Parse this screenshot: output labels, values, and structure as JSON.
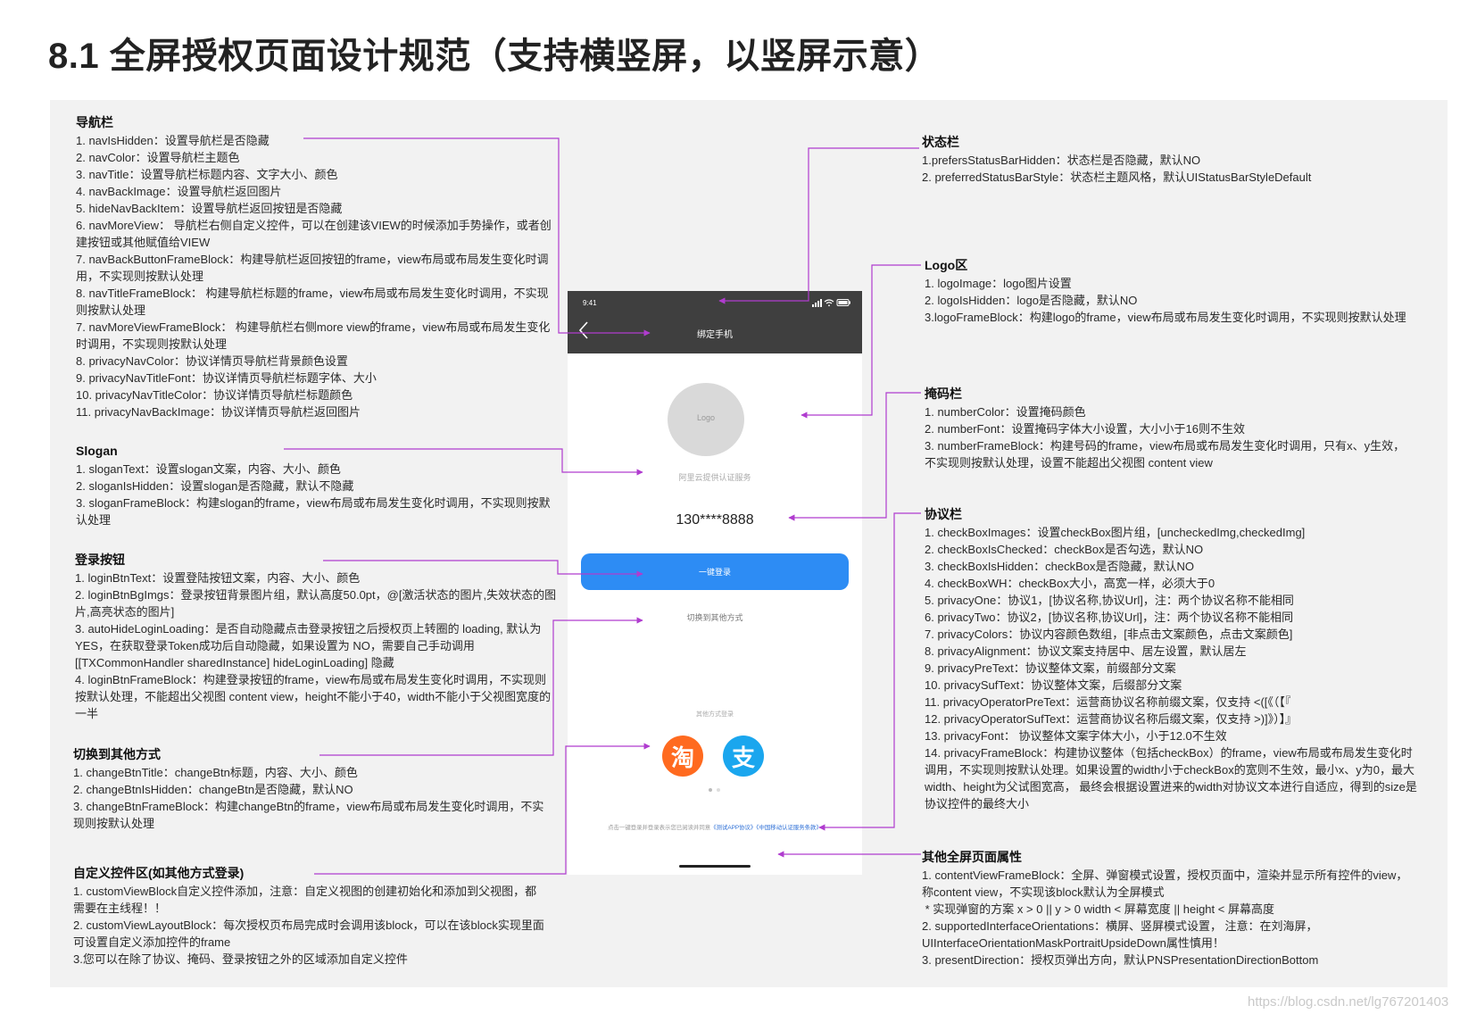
{
  "title": "8.1 全屏授权页面设计规范（支持横竖屏，以竖屏示意）",
  "colors": {
    "connector": "#b03ccf",
    "login_button": "#2d8cf4",
    "nav_bar": "#3f3f3f",
    "panel": "#f2f2f2"
  },
  "sections": {
    "nav": {
      "head": "导航栏",
      "lines": [
        "1. navIsHidden：设置导航栏是否隐藏",
        "2. navColor：设置导航栏主题色",
        "3. navTitle：设置导航栏标题内容、文字大小、颜色",
        "4. navBackImage：设置导航栏返回图片",
        "5. hideNavBackItem：设置导航栏返回按钮是否隐藏",
        "6. navMoreView： 导航栏右侧自定义控件，可以在创建该VIEW的时候添加手势操作，或者创建按钮或其他赋值给VIEW",
        "7. navBackButtonFrameBlock：构建导航栏返回按钮的frame，view布局或布局发生变化时调用，不实现则按默认处理",
        "8. navTitleFrameBlock： 构建导航栏标题的frame，view布局或布局发生变化时调用，不实现则按默认处理",
        "7. navMoreViewFrameBlock： 构建导航栏右侧more view的frame，view布局或布局发生变化时调用，不实现则按默认处理",
        "8. privacyNavColor：协议详情页导航栏背景颜色设置",
        "9. privacyNavTitleFont：协议详情页导航栏标题字体、大小",
        "10. privacyNavTitleColor：协议详情页导航栏标题颜色",
        "11. privacyNavBackImage：协议详情页导航栏返回图片"
      ]
    },
    "slogan": {
      "head": "Slogan",
      "lines": [
        "1. sloganText：设置slogan文案，内容、大小、颜色",
        "2. sloganIsHidden：设置slogan是否隐藏，默认不隐藏",
        "3. sloganFrameBlock：构建slogan的frame，view布局或布局发生变化时调用，不实现则按默认处理"
      ]
    },
    "login": {
      "head": "登录按钮",
      "lines": [
        "1. loginBtnText：设置登陆按钮文案，内容、大小、颜色",
        "2. loginBtnBgImgs：登录按钮背景图片组，默认高度50.0pt，@[激活状态的图片,失效状态的图片,高亮状态的图片]",
        "3. autoHideLoginLoading：是否自动隐藏点击登录按钮之后授权页上转圈的 loading, 默认为YES，在获取登录Token成功后自动隐藏，如果设置为 NO，需要自己手动调用 [[TXCommonHandler sharedInstance] hideLoginLoading] 隐藏",
        "4. loginBtnFrameBlock：构建登录按钮的frame，view布局或布局发生变化时调用，不实现则按默认处理，不能超出父视图 content view，height不能小于40，width不能小于父视图宽度的一半"
      ]
    },
    "switch": {
      "head": "切换到其他方式",
      "lines": [
        "1. changeBtnTitle：changeBtn标题，内容、大小、颜色",
        "2. changeBtnIsHidden：changeBtn是否隐藏，默认NO",
        "3. changeBtnFrameBlock：构建changeBtn的frame，view布局或布局发生变化时调用，不实现则按默认处理"
      ]
    },
    "custom": {
      "head": "自定义控件区(如其他方式登录)",
      "lines": [
        "1. customViewBlock自定义控件添加，注意：自定义视图的创建初始化和添加到父视图，都需要在主线程！！",
        "2. customViewLayoutBlock：每次授权页布局完成时会调用该block，可以在该block实现里面可设置自定义添加控件的frame",
        "3.您可以在除了协议、掩码、登录按钮之外的区域添加自定义控件"
      ]
    },
    "status": {
      "head": "状态栏",
      "lines": [
        "1.prefersStatusBarHidden：状态栏是否隐藏，默认NO",
        "2. preferredStatusBarStyle：状态栏主题风格，默认UIStatusBarStyleDefault"
      ]
    },
    "logo": {
      "head": "Logo区",
      "lines": [
        "1. logoImage：logo图片设置",
        "2. logoIsHidden：logo是否隐藏，默认NO",
        "3.logoFrameBlock：构建logo的frame，view布局或布局发生变化时调用，不实现则按默认处理"
      ]
    },
    "number": {
      "head": "掩码栏",
      "lines": [
        "1. numberColor：设置掩码颜色",
        "2. numberFont：设置掩码字体大小设置，大小小于16则不生效",
        "3. numberFrameBlock：构建号码的frame，view布局或布局发生变化时调用，只有x、y生效，不实现则按默认处理，设置不能超出父视图 content view"
      ]
    },
    "privacy": {
      "head": "协议栏",
      "lines": [
        "1. checkBoxImages：设置checkBox图片组，[uncheckedImg,checkedImg]",
        "2. checkBoxIsChecked：checkBox是否勾选，默认NO",
        "3. checkBoxIsHidden：checkBox是否隐藏，默认NO",
        "4. checkBoxWH：checkBox大小，高宽一样，必须大于0",
        "5. privacyOne：协议1，[协议名称,协议Url]，注：两个协议名称不能相同",
        "6. privacyTwo：协议2，[协议名称,协议Url]，注：两个协议名称不能相同",
        "7. privacyColors：协议内容颜色数组，[非点击文案颜色，点击文案颜色]",
        "8. privacyAlignment：协议文案支持居中、居左设置，默认居左",
        "9. privacyPreText：协议整体文案，前缀部分文案",
        "10. privacySufText：协议整体文案，后缀部分文案",
        "11. privacyOperatorPreText：运营商协议名称前缀文案，仅支持 <([《（【『",
        "12. privacyOperatorSufText：运营商协议名称后缀文案，仅支持 >)]》）】』",
        "13. privacyFont： 协议整体文案字体大小，小于12.0不生效",
        "14. privacyFrameBlock：构建协议整体（包括checkBox）的frame，view布局或布局发生变化时调用，不实现则按默认处理。如果设置的width小于checkBox的宽则不生效，最小x、y为0，最大width、height为父试图宽高， 最终会根据设置进来的width对协议文本进行自适应，得到的size是协议控件的最终大小"
      ]
    },
    "other": {
      "head": "其他全屏页面属性",
      "lines": [
        "1. contentViewFrameBlock：全屏、弹窗模式设置，授权页面中，渲染并显示所有控件的view，称content view，不实现该block默认为全屏模式",
        " * 实现弹窗的方案 x > 0 || y > 0 width < 屏幕宽度 || height < 屏幕高度",
        "2. supportedInterfaceOrientations：横屏、竖屏模式设置， 注意：在刘海屏，UIInterfaceOrientationMaskPortraitUpsideDown属性慎用！",
        "3. presentDirection：授权页弹出方向，默认PNSPresentationDirectionBottom"
      ]
    }
  },
  "phone": {
    "time": "9:41",
    "nav_title": "绑定手机",
    "logo_text": "Logo",
    "slogan": "阿里云提供认证服务",
    "number": "130****8888",
    "login_btn": "一键登录",
    "switch_text": "切换到其他方式",
    "other_label": "其他方式登录",
    "taobao_glyph": "淘",
    "alipay_glyph": "支",
    "privacy_pre": "点击一键登录并登录表示您已阅读并同意",
    "privacy_link1": "《测试APP协议》",
    "privacy_link2": "《中国移动认证服务条款》",
    "icons": [
      "back-chevron-icon",
      "signal-icon",
      "wifi-icon",
      "battery-icon",
      "taobao-icon",
      "alipay-icon"
    ]
  },
  "watermark": "https://blog.csdn.net/lg767201403"
}
